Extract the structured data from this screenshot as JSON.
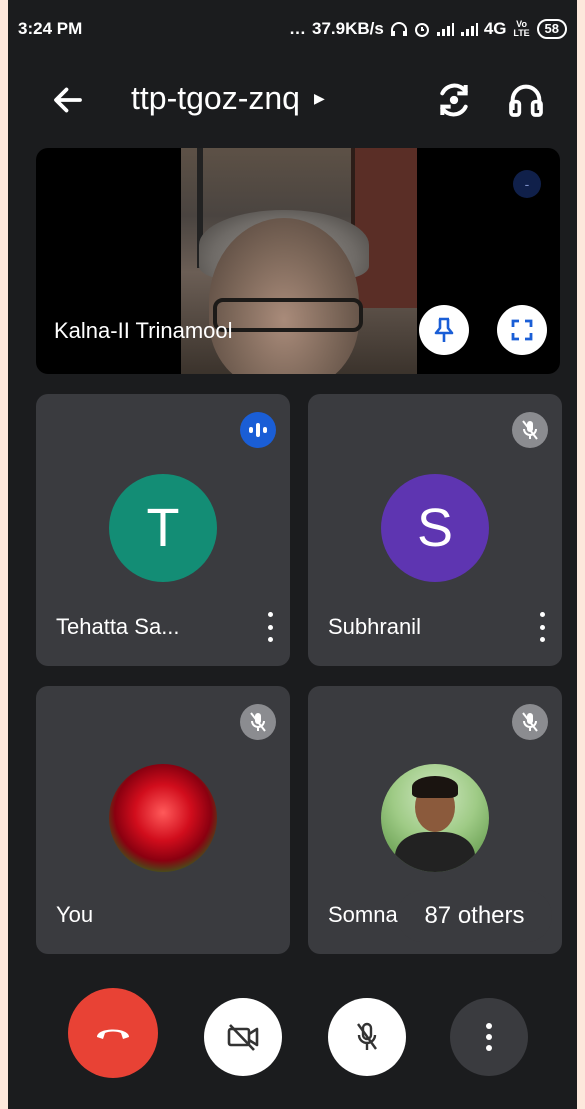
{
  "status_bar": {
    "time": "3:24 PM",
    "network_speed": "37.9KB/s",
    "network_type": "4G",
    "carrier_tag": "Vo LTE",
    "battery": "58"
  },
  "header": {
    "meeting_code": "ttp-tgoz-znq"
  },
  "main_tile": {
    "participant_name": "Kalna-II Trinamool",
    "speaker_indicator": "-"
  },
  "tiles": [
    {
      "name": "Tehatta Sa...",
      "initial": "T",
      "avatar_color": "#138d75",
      "status": "speaking"
    },
    {
      "name": "Subhranil",
      "initial": "S",
      "avatar_color": "#5e35b1",
      "status": "muted"
    },
    {
      "name": "You",
      "status": "muted"
    },
    {
      "name": "Somnath",
      "status": "muted"
    }
  ],
  "others_count_label": "87 others",
  "controls": {
    "end_call_color": "#e84235",
    "accent_blue": "#1a5ed6"
  }
}
